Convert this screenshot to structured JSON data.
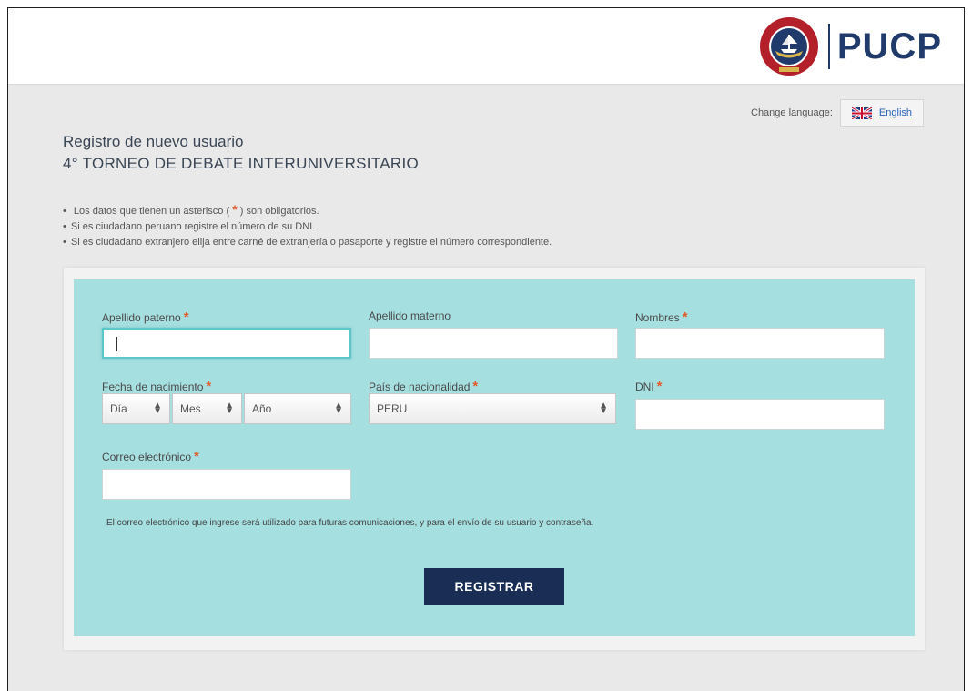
{
  "header": {
    "logo_text": "PUCP"
  },
  "language": {
    "label": "Change language:",
    "link_text": "English"
  },
  "titles": {
    "registro": "Registro de nuevo usuario",
    "torneo": "4° TORNEO DE DEBATE INTERUNIVERSITARIO"
  },
  "notes": {
    "required_before": "Los datos que tienen un asterisco (",
    "required_star": "*",
    "required_after": ") son obligatorios.",
    "peruano": "Si es ciudadano peruano registre el número de su DNI.",
    "extranjero": "Si es ciudadano extranjero elija entre carné de extranjería o pasaporte y registre el número correspondiente."
  },
  "form": {
    "asterisk": "*",
    "apellido_paterno": {
      "label": "Apellido paterno",
      "value": ""
    },
    "apellido_materno": {
      "label": "Apellido materno",
      "value": ""
    },
    "nombres": {
      "label": "Nombres",
      "value": ""
    },
    "fecha_nacimiento": {
      "label": "Fecha de nacimiento",
      "dia": "Día",
      "mes": "Mes",
      "anio": "Año"
    },
    "pais": {
      "label": "País de nacionalidad",
      "selected": "PERU"
    },
    "dni": {
      "label": "DNI",
      "value": ""
    },
    "correo": {
      "label": "Correo electrónico",
      "value": ""
    },
    "hint": "El correo electrónico que ingrese será utilizado para futuras comunicaciones, y para el envío de su usuario y contraseña.",
    "submit_label": "REGISTRAR"
  },
  "colors": {
    "panel": "#a6dfe0",
    "button": "#1a2e55",
    "asterisk": "#e25c2b",
    "brand": "#1f3a6b"
  }
}
